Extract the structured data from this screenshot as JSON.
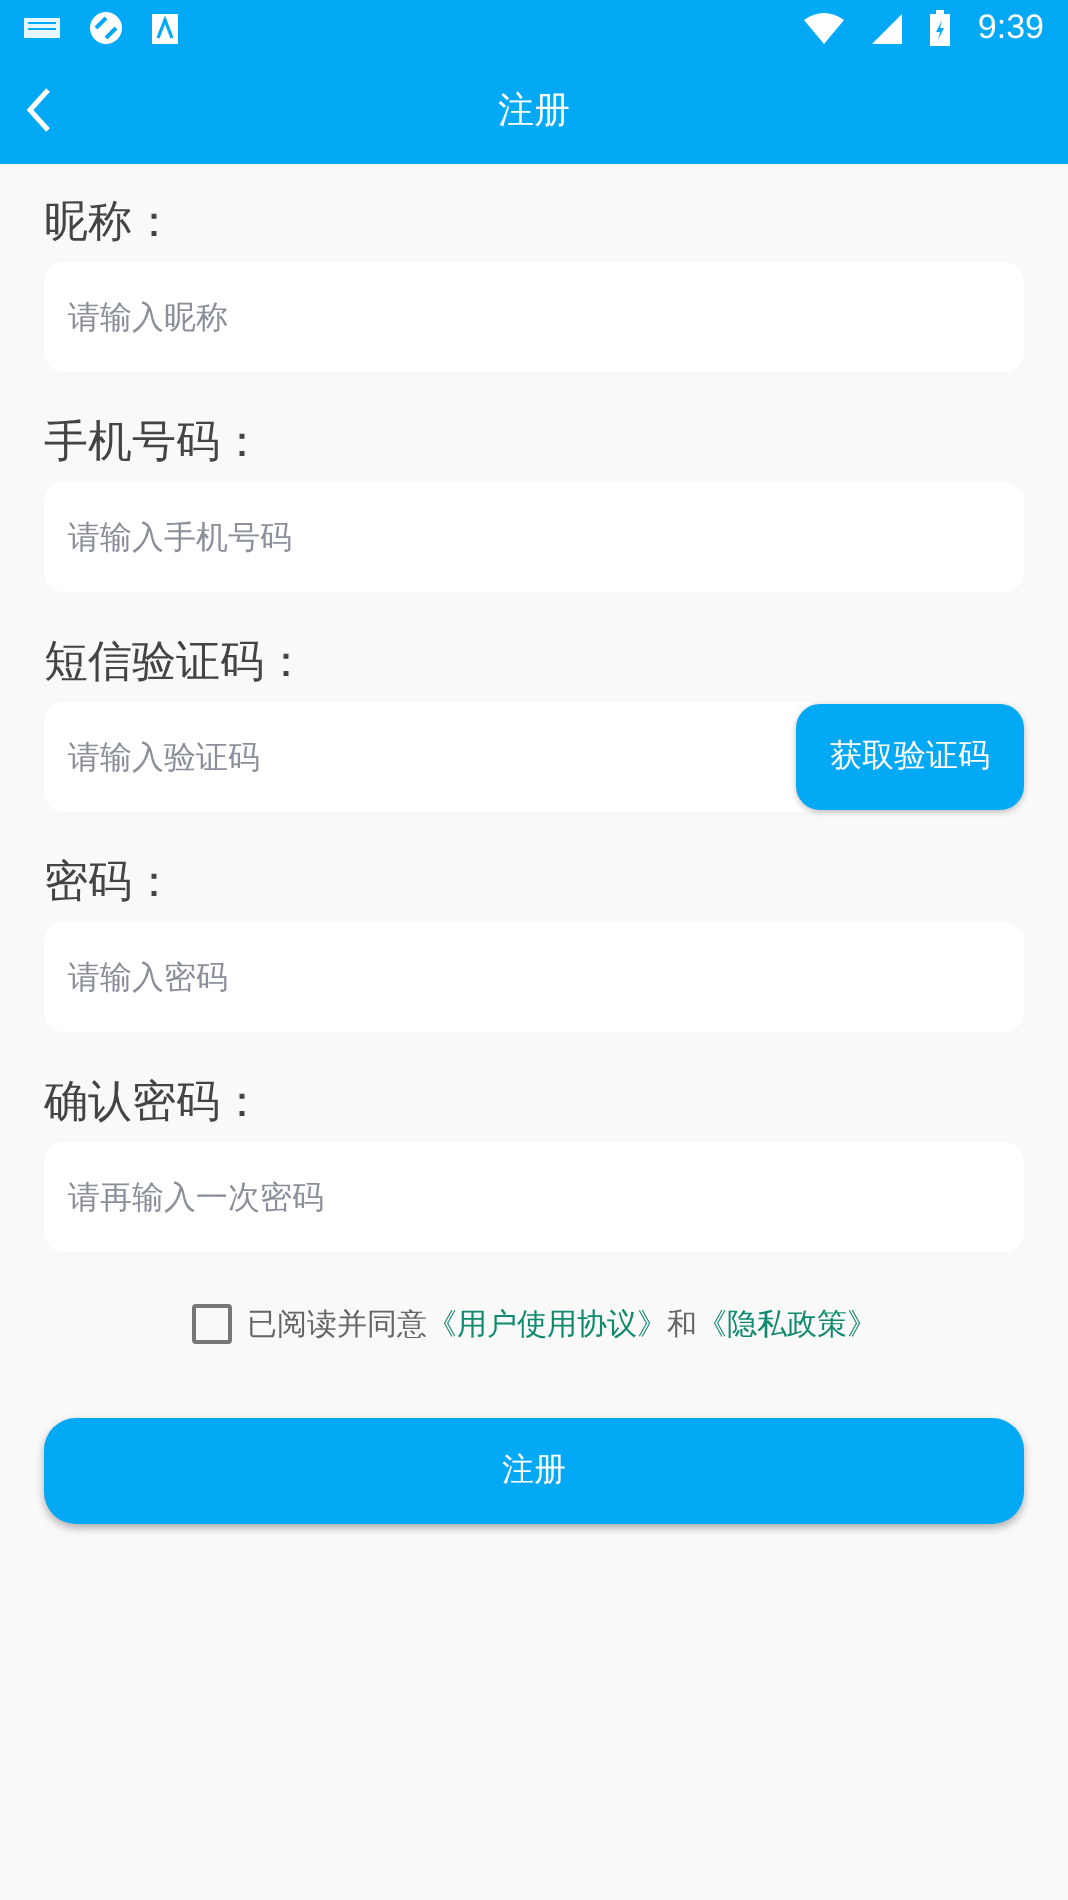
{
  "status_bar": {
    "time": "9:39"
  },
  "app_bar": {
    "title": "注册"
  },
  "fields": [
    {
      "label": "昵称：",
      "placeholder": "请输入昵称"
    },
    {
      "label": "手机号码：",
      "placeholder": "请输入手机号码"
    },
    {
      "label": "短信验证码：",
      "placeholder": "请输入验证码",
      "button": "获取验证码"
    },
    {
      "label": "密码：",
      "placeholder": "请输入密码"
    },
    {
      "label": "确认密码：",
      "placeholder": "请再输入一次密码"
    }
  ],
  "agreement": {
    "checked": false,
    "text": "已阅读并同意",
    "link_1": "《用户使用协议》",
    "and": "和",
    "link_2": "《隐私政策》"
  },
  "submit": "注册"
}
